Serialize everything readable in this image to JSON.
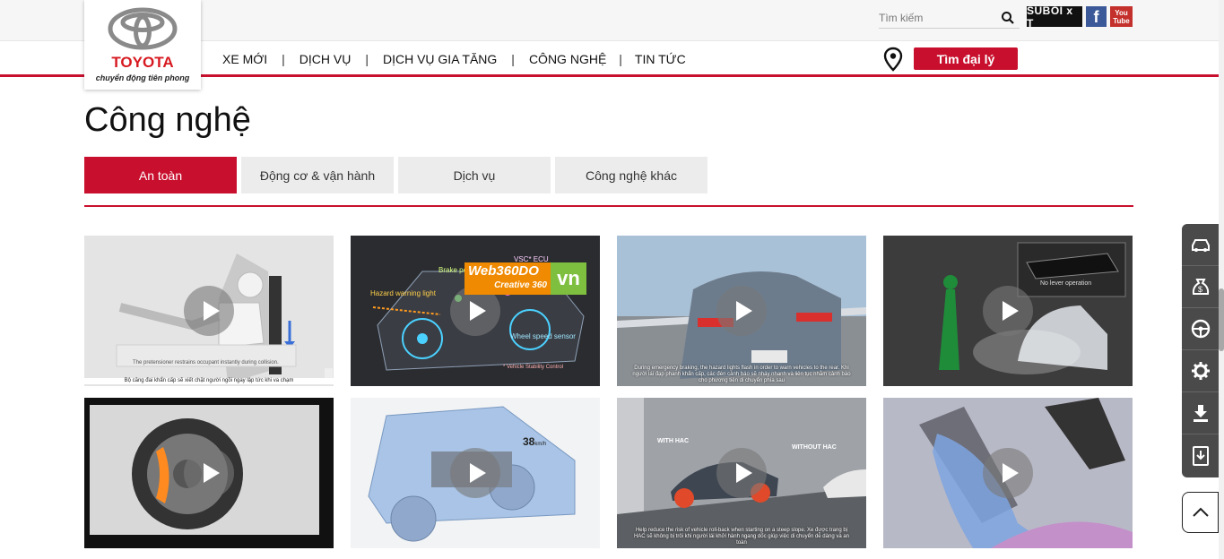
{
  "header": {
    "search_placeholder": "Tìm kiếm",
    "social": {
      "suboi": "SUBOI x T",
      "facebook": "f",
      "youtube_top": "You",
      "youtube_bottom": "Tube"
    }
  },
  "logo": {
    "brand": "TOYOTA",
    "tagline": "chuyển động tiên phong"
  },
  "nav": {
    "items": [
      "XE MỚI",
      "DỊCH VỤ",
      "DỊCH VỤ GIA TĂNG",
      "CÔNG NGHỆ",
      "TIN TỨC"
    ],
    "separator": "|",
    "dealer_button": "Tìm đại lý"
  },
  "page": {
    "title": "Công nghệ"
  },
  "tabs": [
    {
      "label": "An toàn",
      "active": true
    },
    {
      "label": "Động cơ & vận hành",
      "active": false
    },
    {
      "label": "Dịch vụ",
      "active": false
    },
    {
      "label": "Công nghệ khác",
      "active": false
    }
  ],
  "videos": [
    {
      "caption": "Bộ căng đai khẩn cấp sẽ xiết chặt người ngồi ngay lập tức khi va chạm",
      "overlay_text": "The pretensioner restrains occupant instantly during collision."
    },
    {
      "labels": [
        "Brake pedal",
        "VSC* ECU",
        "Hazard warning light",
        "Wheel speed sensor",
        "* Vehicle Stability Control"
      ]
    },
    {
      "caption": "During emergency braking, the hazard lights flash in order to warn vehicles to the rear. Khi người lái đạp phanh khẩn cấp, các đèn cảnh báo sẽ nháy nhanh và liên tục nhằm cảnh báo cho phương tiện di chuyển phía sau"
    },
    {
      "overlay_text": "No lever operation"
    },
    {},
    {
      "speed": "38",
      "speed_unit": "km/h"
    },
    {
      "labels": [
        "WITH HAC",
        "WITHOUT HAC"
      ],
      "caption": "Help reduce the risk of vehicle roll-back when starting on a steep slope. Xe được trang bị HAC sẽ không bị trôi khi người lái khởi hành ngang dốc giúp việc di chuyển dễ dàng và an toàn"
    },
    {}
  ],
  "watermark": {
    "line1": "Web360DO",
    "line2": "Creative 360",
    "tld": "vn"
  },
  "colors": {
    "brand_red": "#c8102e",
    "dock_gray": "#4a4a4a"
  }
}
